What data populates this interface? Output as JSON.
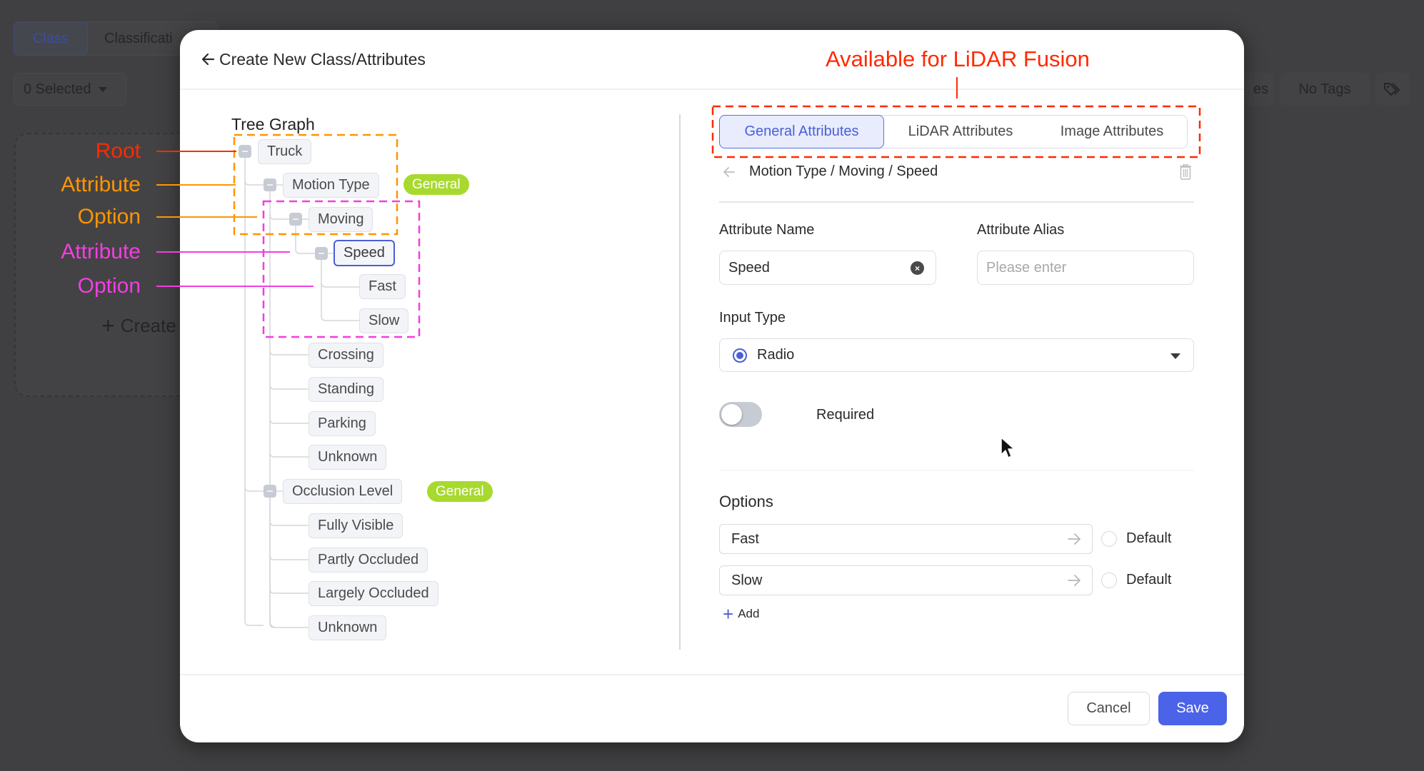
{
  "background": {
    "tabs": [
      {
        "label": "Class",
        "active": true
      },
      {
        "label": "Classificati",
        "active": false
      }
    ],
    "selected_dropdown": "0 Selected",
    "create_label": "Create",
    "partial_button_label": "es",
    "tags_button_label": "No Tags",
    "tag_icon": "tag-icon"
  },
  "modal": {
    "title": "Create New Class/Attributes",
    "back_icon": "arrow-left-icon",
    "tree": {
      "title": "Tree Graph",
      "nodes": [
        {
          "label": "Truck",
          "type": "root",
          "collapsible": true
        },
        {
          "label": "Motion Type",
          "type": "attribute",
          "collapsible": true,
          "badge": "General"
        },
        {
          "label": "Moving",
          "type": "option",
          "collapsible": true
        },
        {
          "label": "Speed",
          "type": "attribute",
          "collapsible": true,
          "selected": true
        },
        {
          "label": "Fast",
          "type": "option"
        },
        {
          "label": "Slow",
          "type": "option"
        },
        {
          "label": "Crossing",
          "type": "option"
        },
        {
          "label": "Standing",
          "type": "option"
        },
        {
          "label": "Parking",
          "type": "option"
        },
        {
          "label": "Unknown",
          "type": "option"
        },
        {
          "label": "Occlusion Level",
          "type": "attribute",
          "collapsible": true,
          "badge": "General"
        },
        {
          "label": "Fully Visible",
          "type": "option"
        },
        {
          "label": "Partly Occluded",
          "type": "option"
        },
        {
          "label": "Largely Occluded",
          "type": "option"
        },
        {
          "label": "Unknown",
          "type": "option"
        }
      ]
    },
    "annotations": {
      "left": [
        {
          "label": "Root",
          "color": "#ff2a00"
        },
        {
          "label": "Attribute",
          "color": "#ff9500"
        },
        {
          "label": "Option",
          "color": "#ff9500"
        },
        {
          "label": "Attribute",
          "color": "#f23ee0"
        },
        {
          "label": "Option",
          "color": "#f23ee0"
        }
      ],
      "top": {
        "label": "Available for LiDAR Fusion",
        "color": "#ff2a00"
      }
    },
    "tabs": [
      {
        "label": "General Attributes",
        "active": true
      },
      {
        "label": "LiDAR Attributes",
        "active": false
      },
      {
        "label": "Image Attributes",
        "active": false
      }
    ],
    "breadcrumb": "Motion Type / Moving / Speed",
    "form": {
      "attribute_name_label": "Attribute Name",
      "attribute_name_value": "Speed",
      "attribute_alias_label": "Attribute Alias",
      "attribute_alias_placeholder": "Please enter",
      "input_type_label": "Input Type",
      "input_type_value": "Radio",
      "required_label": "Required",
      "required_on": false,
      "options_label": "Options",
      "options": [
        {
          "value": "Fast",
          "default_label": "Default",
          "is_default": false
        },
        {
          "value": "Slow",
          "default_label": "Default",
          "is_default": false
        }
      ],
      "add_label": "Add"
    },
    "footer": {
      "cancel_label": "Cancel",
      "save_label": "Save"
    },
    "colors": {
      "accent": "#4b63e8",
      "badge": "#a8d92e",
      "annotation_root": "#ff2a00",
      "annotation_level1": "#ff9500",
      "annotation_level2": "#f23ee0"
    }
  }
}
